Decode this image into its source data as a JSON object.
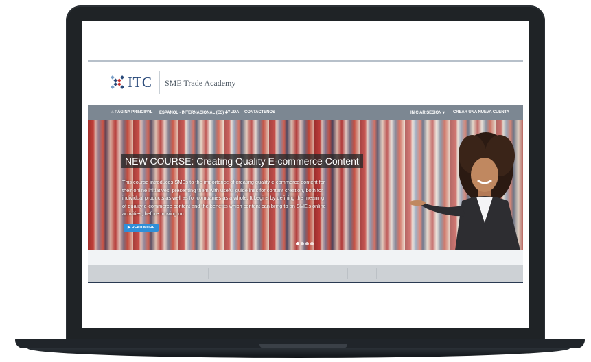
{
  "site": {
    "logo_text": "ITC",
    "logo_sub": "SME Trade Academy"
  },
  "nav": {
    "home": "PÁGINA PRINCIPAL",
    "language": "ESPAÑOL - INTERNACIONAL (ES) ▾",
    "help": "AYUDA",
    "contact": "CONTACTENOS",
    "login": "INICIAR SESIÓN ▾",
    "signup": "CREAR UNA NUEVA CUENTA"
  },
  "hero": {
    "title": "NEW COURSE: Creating Quality E-commerce Content",
    "text": "This course introduces SMEs to the importance of creating quality e-commerce content for their online initiatives, presenting them with useful guidelines for content creation, both for individual products as well as for companies as a whole. It begins by defining the meaning of quality e-commerce content and the benefits which content can bring to an SME's online activities, before moving on",
    "read_more": "▶ READ MORE",
    "slide_count": 4,
    "active_slide": 1
  },
  "colors": {
    "navbar": "#7c8792",
    "button": "#2f8fd8",
    "logo": "#2a4a7a",
    "bezel": "#1f2326"
  }
}
